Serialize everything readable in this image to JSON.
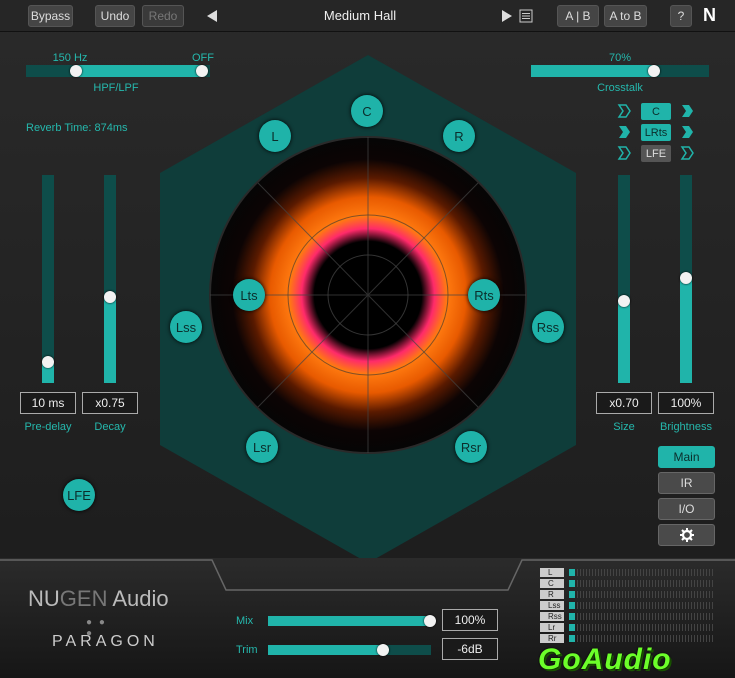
{
  "toolbar": {
    "bypass": "Bypass",
    "undo": "Undo",
    "redo": "Redo",
    "preset": "Medium Hall",
    "ab": "A | B",
    "atob": "A to B",
    "help": "?",
    "logo": "N"
  },
  "filters": {
    "hpf_value": "150 Hz",
    "lpf_value": "OFF",
    "label": "HPF/LPF",
    "hpf_pos": 0.25,
    "lpf_pos": 1.0
  },
  "crosstalk": {
    "value": "70%",
    "label": "Crosstalk",
    "level": 0.7
  },
  "reverb_time": "Reverb Time: 874ms",
  "left_sliders": [
    {
      "value": "10 ms",
      "label": "Pre-delay",
      "level": 0.1
    },
    {
      "value": "x0.75",
      "label": "Decay",
      "level": 0.42
    }
  ],
  "right_sliders": [
    {
      "value": "x0.70",
      "label": "Size",
      "level": 0.4
    },
    {
      "value": "100%",
      "label": "Brightness",
      "level": 0.5
    }
  ],
  "channel_buttons": [
    "C",
    "LRts",
    "LFE"
  ],
  "speakers": [
    "C",
    "L",
    "R",
    "Lss",
    "Rss",
    "Lts",
    "Rts",
    "Lsr",
    "Rsr",
    "LFE"
  ],
  "side_buttons": {
    "main": "Main",
    "ir": "IR",
    "io": "I/O",
    "settings": "gear-icon"
  },
  "brand": {
    "name1": "NU",
    "name2": "GEN",
    "name3": " Audio",
    "product": "PARAGON"
  },
  "mix": {
    "label": "Mix",
    "value": "100%",
    "level": 1.0
  },
  "trim": {
    "label": "Trim",
    "value": "-6dB",
    "level": 0.71
  },
  "meters": [
    {
      "name": "L"
    },
    {
      "name": "C"
    },
    {
      "name": "R"
    },
    {
      "name": "Lss"
    },
    {
      "name": "Rss"
    },
    {
      "name": "Lr"
    },
    {
      "name": "Rr"
    }
  ],
  "watermark": "GoAudio",
  "colors": {
    "accent": "#20b4aa",
    "background": "#1f1f1f",
    "ring": "#ff6a00"
  }
}
